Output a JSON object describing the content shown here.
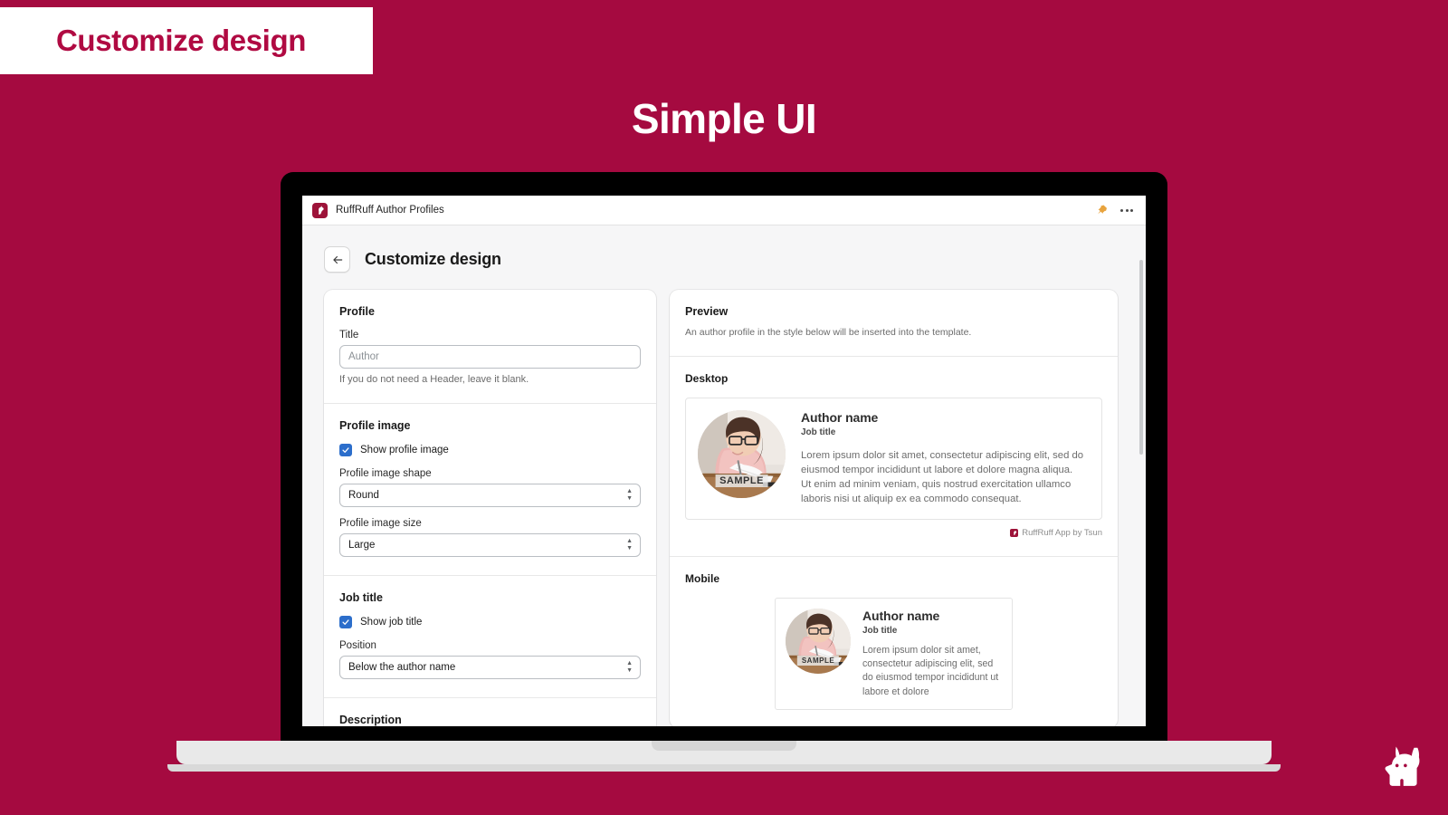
{
  "promo": {
    "banner_label": "Customize design",
    "headline": "Simple UI",
    "banner_bg": "#FFFFFF",
    "banner_text_color": "#B00A42",
    "page_bg": "#A50A40"
  },
  "app": {
    "topbar": {
      "logo_icon": "ruffruff-dog-logo-icon",
      "title": "RuffRuff Author Profiles",
      "pin_icon": "pin-icon",
      "more_icon": "more-horizontal-icon"
    },
    "header": {
      "back_icon": "arrow-left-icon",
      "page_title": "Customize design"
    }
  },
  "profile_card": {
    "sections": [
      {
        "title": "Profile",
        "field_label": "Title",
        "input_placeholder": "Author",
        "input_value": "",
        "help_text": "If you do not need a Header, leave it blank."
      },
      {
        "title": "Profile image",
        "checkbox_label": "Show profile image",
        "checkbox_checked": true,
        "shape_label": "Profile image shape",
        "shape_value": "Round",
        "size_label": "Profile image size",
        "size_value": "Large"
      },
      {
        "title": "Job title",
        "checkbox_label": "Show job title",
        "checkbox_checked": true,
        "position_label": "Position",
        "position_value": "Below the author name"
      },
      {
        "title": "Description"
      }
    ]
  },
  "preview_card": {
    "title": "Preview",
    "subtitle": "An author profile in the style below will be inserted into the template.",
    "desktop": {
      "label": "Desktop",
      "author_name": "Author name",
      "job_title": "Job title",
      "paragraph_1": "Lorem ipsum dolor sit amet, consectetur adipiscing elit, sed do eiusmod tempor incididunt ut labore et dolore magna aliqua.",
      "paragraph_2": "Ut enim ad minim veniam, quis nostrud exercitation ullamco laboris nisi ut aliquip ex ea commodo consequat.",
      "avatar_watermark": "SAMPLE",
      "attribution": "RuffRuff App by Tsun"
    },
    "mobile": {
      "label": "Mobile",
      "author_name": "Author name",
      "job_title": "Job title",
      "paragraph_1": "Lorem ipsum dolor sit amet, consectetur adipiscing elit, sed do eiusmod tempor incididunt ut labore et dolore",
      "avatar_watermark": "SAMPLE"
    }
  },
  "corner": {
    "logo_icon": "ruffruff-dog-head-icon"
  }
}
